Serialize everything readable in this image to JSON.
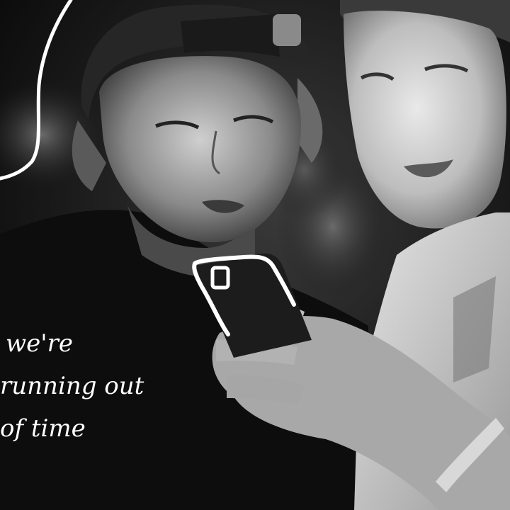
{
  "scene": {
    "type": "black-and-white photo",
    "subjects": [
      "man in backwards cap looking at phone",
      "young man holding phone"
    ],
    "doodles": [
      "white outline around phone",
      "white scribble line top-left"
    ]
  },
  "caption": {
    "lines": [
      "we're",
      "running out",
      "of time"
    ]
  },
  "colors": {
    "doodle": "#ffffff",
    "background": "#111111"
  }
}
